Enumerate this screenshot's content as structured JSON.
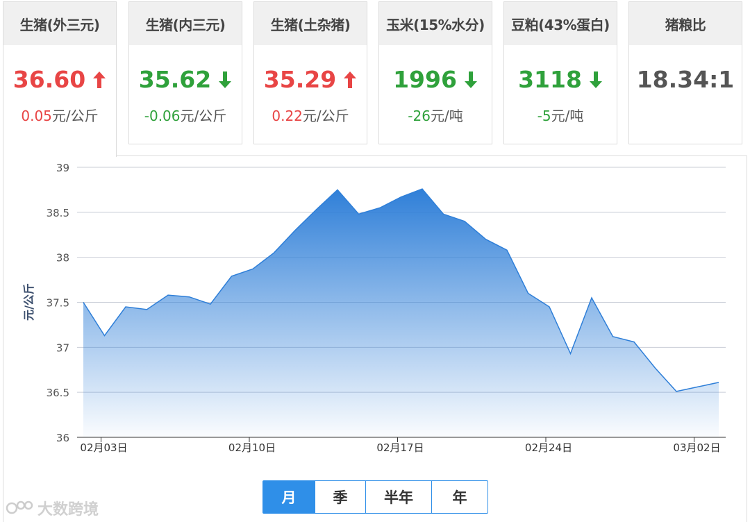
{
  "cards": [
    {
      "title": "生猪(外三元)",
      "price": "36.60",
      "direction": "up",
      "change_num": "0.05",
      "unit": "元/公斤",
      "color": "#e84545"
    },
    {
      "title": "生猪(内三元)",
      "price": "35.62",
      "direction": "down",
      "change_num": "-0.06",
      "unit": "元/公斤",
      "color": "#2fa13b"
    },
    {
      "title": "生猪(土杂猪)",
      "price": "35.29",
      "direction": "up",
      "change_num": "0.22",
      "unit": "元/公斤",
      "color": "#e84545"
    },
    {
      "title": "玉米(15%水分)",
      "price": "1996",
      "direction": "down",
      "change_num": "-26",
      "unit": "元/吨",
      "color": "#2fa13b"
    },
    {
      "title": "豆粕(43%蛋白)",
      "price": "3118",
      "direction": "down",
      "change_num": "-5",
      "unit": "元/吨",
      "color": "#2fa13b"
    },
    {
      "title": "猪粮比",
      "price": "18.34:1",
      "direction": "none",
      "change_num": "",
      "unit": "",
      "color": "#555555"
    }
  ],
  "tabs": [
    "月",
    "季",
    "半年",
    "年"
  ],
  "selected_tab": "月",
  "watermark": "大数跨境",
  "chart_data": {
    "type": "area",
    "ylabel": "元/公斤",
    "ylim": [
      36,
      39
    ],
    "yticks": [
      "36",
      "36.5",
      "37",
      "37.5",
      "38",
      "38.5",
      "39"
    ],
    "xticklabels": [
      "02月03日",
      "02月10日",
      "02月17日",
      "02月24日",
      "03月02日"
    ],
    "xtick_index": [
      1,
      8,
      15,
      22,
      29
    ],
    "grid": true,
    "color": "#2f7fd8",
    "series": [
      {
        "values": [
          37.5,
          37.13,
          37.45,
          37.42,
          37.58,
          37.56,
          37.48,
          37.79,
          37.87,
          38.05,
          38.3,
          38.53,
          38.75,
          38.48,
          38.55,
          38.67,
          38.76,
          38.48,
          38.4,
          38.2,
          38.08,
          37.6,
          37.45,
          36.93,
          37.55,
          37.12,
          37.06,
          36.77,
          36.51,
          36.56,
          36.61
        ]
      }
    ]
  }
}
